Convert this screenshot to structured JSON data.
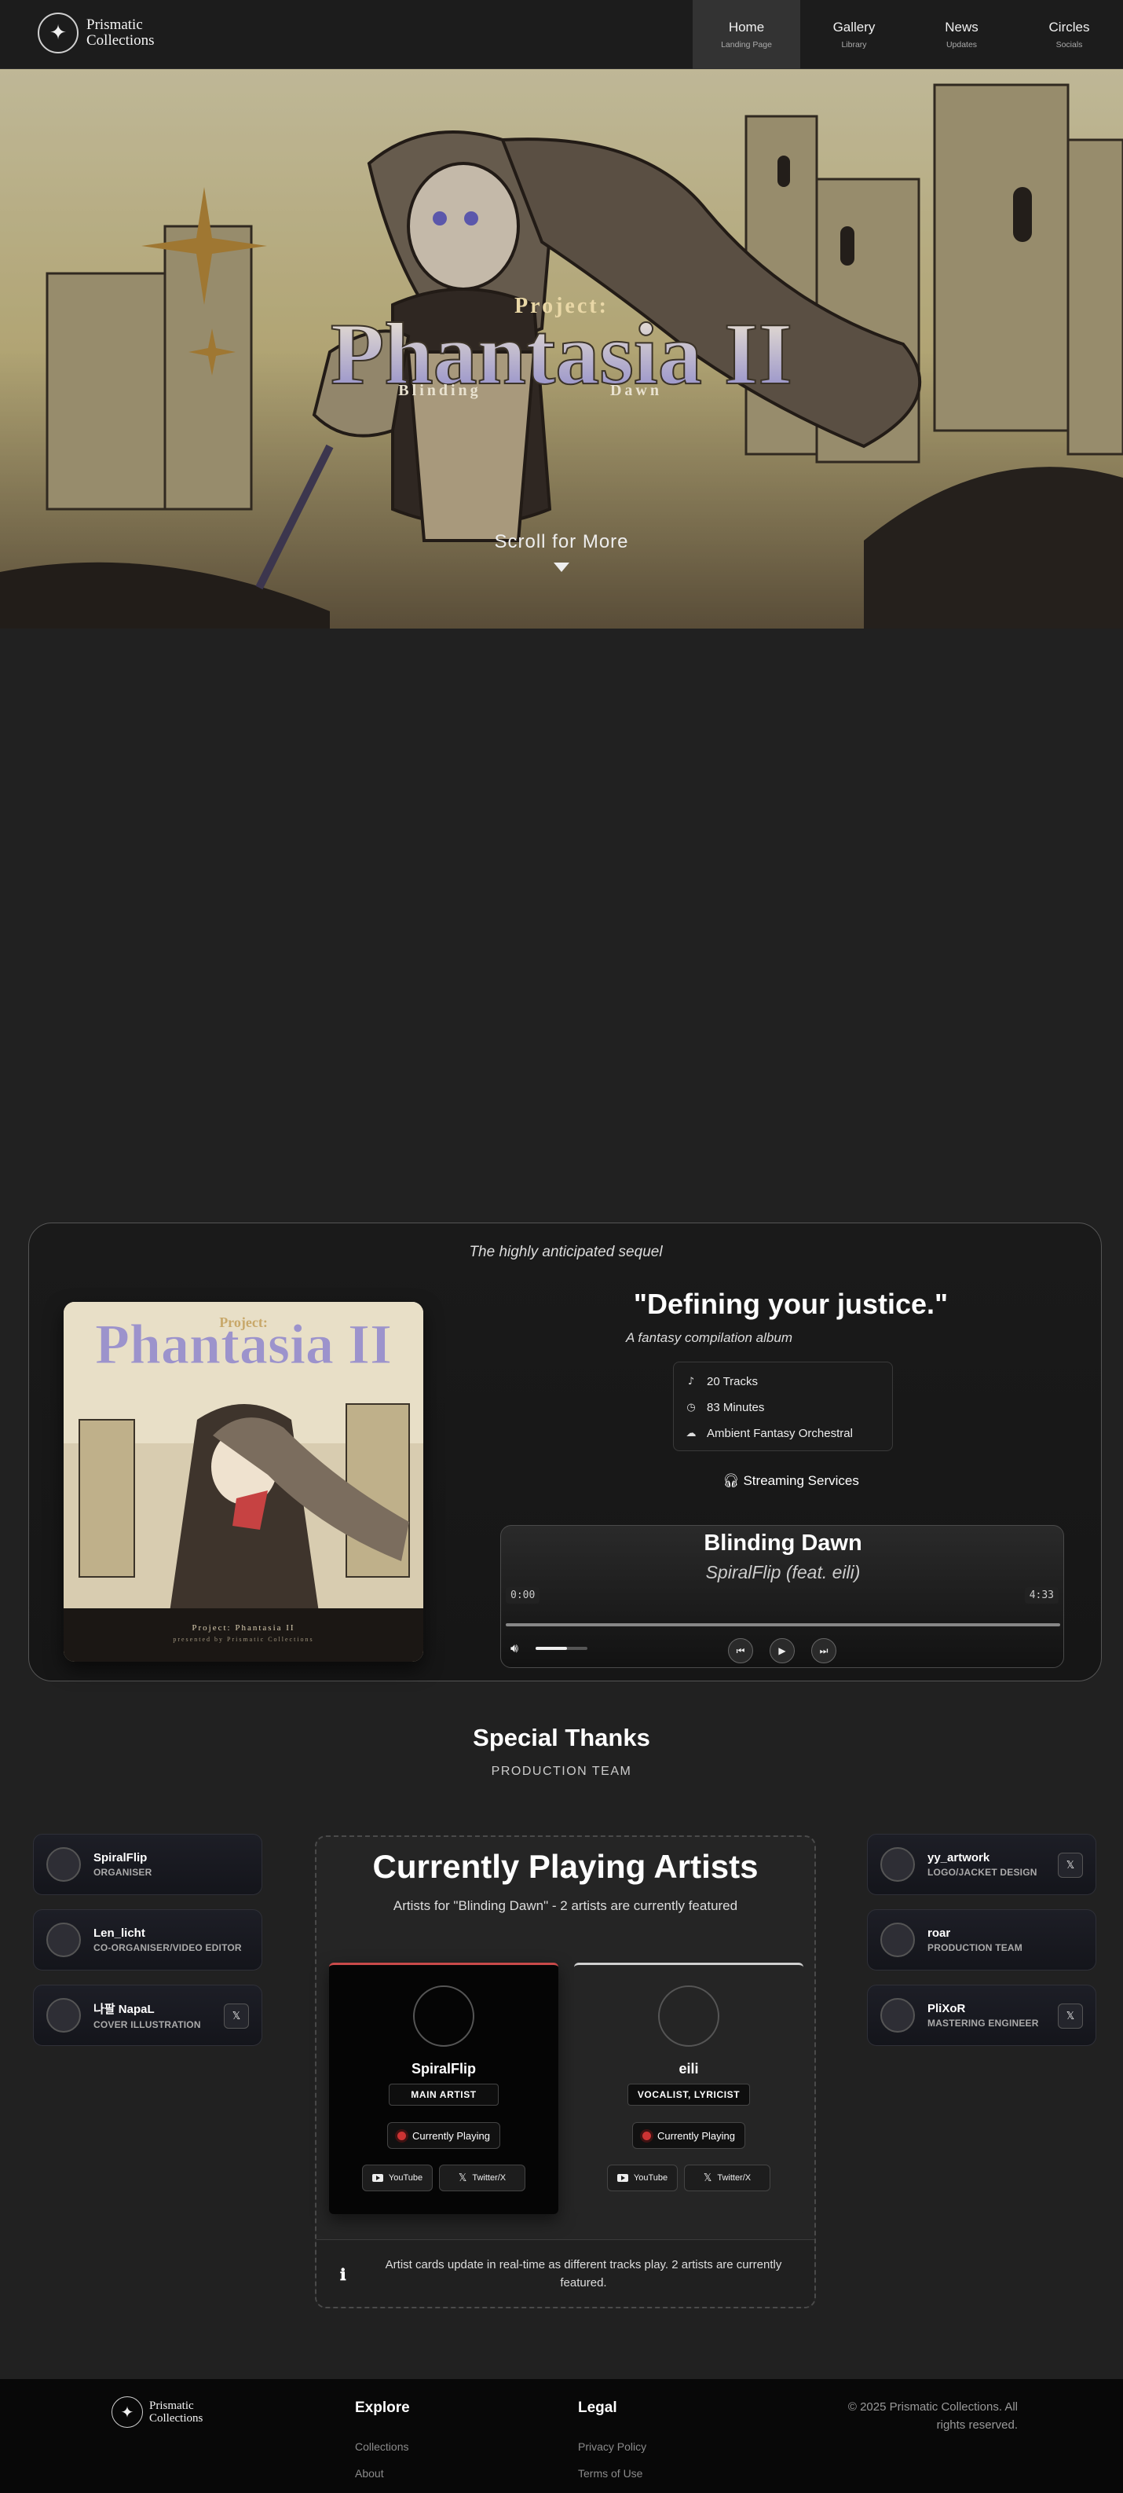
{
  "nav": {
    "logo_line1": "Prismatic",
    "logo_line2": "Collections",
    "items": [
      {
        "label": "Home",
        "sub": "Landing Page"
      },
      {
        "label": "Gallery",
        "sub": "Library"
      },
      {
        "label": "News",
        "sub": "Updates"
      },
      {
        "label": "Circles",
        "sub": "Socials"
      }
    ],
    "active": "Home"
  },
  "hero": {
    "title_small": "Project:",
    "title_main": "Phantasia II",
    "title_left": "Blinding",
    "title_right": "Dawn",
    "scroll_label": "Scroll for More"
  },
  "album": {
    "kicker": "The highly anticipated sequel",
    "cover_caption": "Project: Phantasia II",
    "cover_small": "presented by Prismatic Collections",
    "tagline": "\"Defining your justice.\"",
    "subtag": "A fantasy compilation album",
    "stats": [
      {
        "icon": "music-note-icon",
        "text": "20 Tracks"
      },
      {
        "icon": "clock-icon",
        "text": "83 Minutes"
      },
      {
        "icon": "genre-icon",
        "text": "Ambient Fantasy Orchestral"
      }
    ],
    "streaming_label": "Streaming Services",
    "player": {
      "track": "Blinding Dawn",
      "artist": "SpiralFlip (feat. eili)",
      "time_current": "0:00",
      "time_total": "4:33",
      "progress": 0.0,
      "volume": 0.6
    }
  },
  "thanks": {
    "title": "Special Thanks",
    "subtitle": "PRODUCTION TEAM",
    "left": [
      {
        "name": "SpiralFlip",
        "role": "ORGANISER",
        "x": false
      },
      {
        "name": "Len_licht",
        "role": "CO-ORGANISER/VIDEO EDITOR",
        "x": false
      },
      {
        "name": "나팔 NapaL",
        "role": "COVER ILLUSTRATION",
        "x": true
      }
    ],
    "right": [
      {
        "name": "yy_artwork",
        "role": "LOGO/JACKET DESIGN",
        "x": true
      },
      {
        "name": "roar",
        "role": "PRODUCTION TEAM",
        "x": false
      },
      {
        "name": "PliXoR",
        "role": "MASTERING ENGINEER",
        "x": true
      }
    ]
  },
  "current": {
    "title": "Currently Playing Artists",
    "subtitle": "Artists for \"Blinding Dawn\" - 2 artists are currently featured",
    "artists": [
      {
        "name": "SpiralFlip",
        "role": "MAIN ARTIST",
        "status": "Currently Playing",
        "youtube": "YouTube",
        "twitter": "Twitter/X"
      },
      {
        "name": "eili",
        "role": "VOCALIST, LYRICIST",
        "status": "Currently Playing",
        "youtube": "YouTube",
        "twitter": "Twitter/X"
      }
    ],
    "note": "Artist cards update in real-time as different tracks play. 2 artists are currently featured."
  },
  "footer": {
    "logo_line1": "Prismatic",
    "logo_line2": "Collections",
    "explore_title": "Explore",
    "explore_links": [
      "Collections",
      "About"
    ],
    "legal_title": "Legal",
    "legal_links": [
      "Privacy Policy",
      "Terms of Use"
    ],
    "copyright": "© 2025 Prismatic Collections. All rights reserved."
  }
}
